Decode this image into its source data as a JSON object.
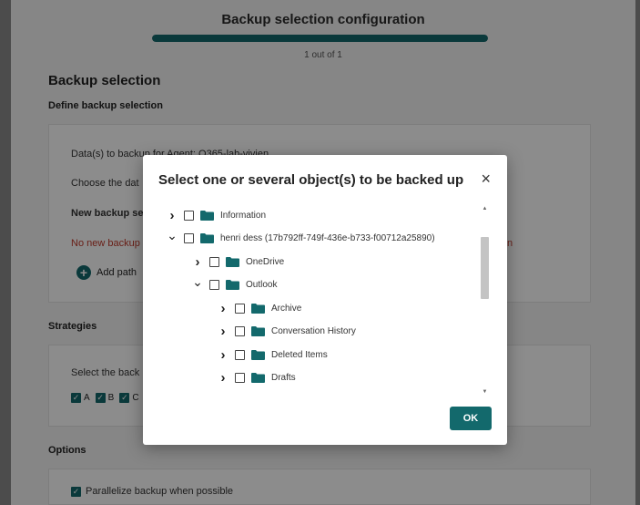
{
  "page": {
    "title": "Backup selection configuration",
    "progress_text": "1 out of 1",
    "progress": 1.0,
    "section_backup": "Backup selection",
    "define_label": "Define backup selection",
    "agent_line": "Data(s) to backup for Agent: O365-lab-vivien",
    "choose_line": "Choose the dat",
    "new_backup_label": "New backup se",
    "no_new_backup": "No new backup",
    "no_new_backup_tail": "n",
    "add_path_label": "Add path",
    "strategies_title": "Strategies",
    "select_backup_line": "Select the back",
    "strategy_checks": [
      "A",
      "B",
      "C"
    ],
    "options_title": "Options",
    "parallelize_label": "Parallelize backup when possible"
  },
  "modal": {
    "title": "Select one or several object(s) to be backed up",
    "close_icon": "×",
    "ok_label": "OK",
    "tree": [
      {
        "label": "Information",
        "level": 0,
        "expanded": false
      },
      {
        "label": "henri dess (17b792ff-749f-436e-b733-f00712a25890)",
        "level": 0,
        "expanded": true
      },
      {
        "label": "OneDrive",
        "level": 1,
        "expanded": false
      },
      {
        "label": "Outlook",
        "level": 1,
        "expanded": true
      },
      {
        "label": "Archive",
        "level": 2,
        "expanded": false
      },
      {
        "label": "Conversation History",
        "level": 2,
        "expanded": false
      },
      {
        "label": "Deleted Items",
        "level": 2,
        "expanded": false
      },
      {
        "label": "Drafts",
        "level": 2,
        "expanded": false
      }
    ]
  },
  "colors": {
    "accent": "#13696c",
    "warning_text": "#c0392b"
  },
  "icons": {
    "expand": "chevron-right-icon",
    "collapse": "chevron-down-icon",
    "folder": "folder-icon",
    "add": "plus-circle-icon",
    "close": "close-icon"
  }
}
